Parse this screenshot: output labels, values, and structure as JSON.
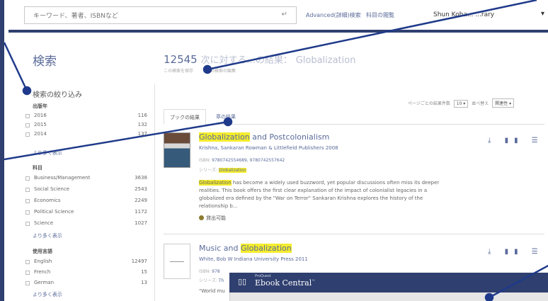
{
  "header": {
    "search_placeholder": "キーワード、著者、ISBNなど",
    "enter_icon": "↵",
    "advanced_label": "Advanced(詳細)検索",
    "browse_label": "科目の閲覧",
    "user_label": "Shun Koha... ...rary",
    "caret": "▾"
  },
  "sidebar": {
    "page_title": "検索",
    "refine_title": "検索の絞り込み",
    "facets": [
      {
        "heading": "出版年",
        "items": [
          {
            "label": "2016",
            "count": "116"
          },
          {
            "label": "2015",
            "count": "132"
          },
          {
            "label": "2014",
            "count": "137"
          }
        ],
        "more": "より多く表示"
      },
      {
        "heading": "科目",
        "items": [
          {
            "label": "Business/Management",
            "count": "3638"
          },
          {
            "label": "Social Science",
            "count": "2543"
          },
          {
            "label": "Economics",
            "count": "2249"
          },
          {
            "label": "Political Science",
            "count": "1172"
          },
          {
            "label": "Science",
            "count": "1027"
          }
        ],
        "more": "より多く表示"
      },
      {
        "heading": "使用言語",
        "items": [
          {
            "label": "English",
            "count": "12497"
          },
          {
            "label": "French",
            "count": "15"
          },
          {
            "label": "German",
            "count": "13"
          }
        ],
        "more": "より多く表示"
      }
    ]
  },
  "results": {
    "count": "12545",
    "count_text": "次に対する...の結果：",
    "query": "Globalization",
    "sub_text": "この検索を保存　　　　の検索の編集",
    "per_page_label": "ページごとの結果件数",
    "per_page_value": "10",
    "sort_label": "並べ替え",
    "sort_value": "関連性",
    "tabs": [
      "ブックの結果",
      "章の結果"
    ],
    "items": [
      {
        "title_hl": "Globalization",
        "title_rest": " and Postcolonialism",
        "authors": "Krishna, Sankaran  Rowman & Littlefield Publishers  2008",
        "isbn_label": "ISBN:",
        "isbn": "9780742554689, 9780742557642",
        "series_label": "シリーズ:",
        "series": "Globalization",
        "desc_hl": "Globalization",
        "desc": " has become a widely used buzzword, yet popular discussions often miss its deeper realities. This book offers the first clear explanation of the impact of colonialist legacies in a globalized era defined by the \"War on Terror\" Sankaran Krishna explores the history of the relationship b...",
        "availability": "貸出可能"
      },
      {
        "title_plain": "Music and ",
        "title_hl": "Globalization",
        "authors": "White, Bob W  Indiana University Press  2011",
        "isbn_label": "ISBN:",
        "isbn": "978",
        "series_label": "シリーズ:",
        "series": "Th",
        "desc": "\"World mu"
      }
    ],
    "action_icons": "⤓ ▮▮ ☰ ▙"
  },
  "overlay": {
    "brand_small": "ProQuest",
    "brand_name": "Ebook Central",
    "tm": "™"
  },
  "colors": {
    "accent": "#5a6b9a",
    "navy": "#2f3f6f",
    "highlight": "#f4ec2d",
    "annotation": "#1f3a8a"
  }
}
